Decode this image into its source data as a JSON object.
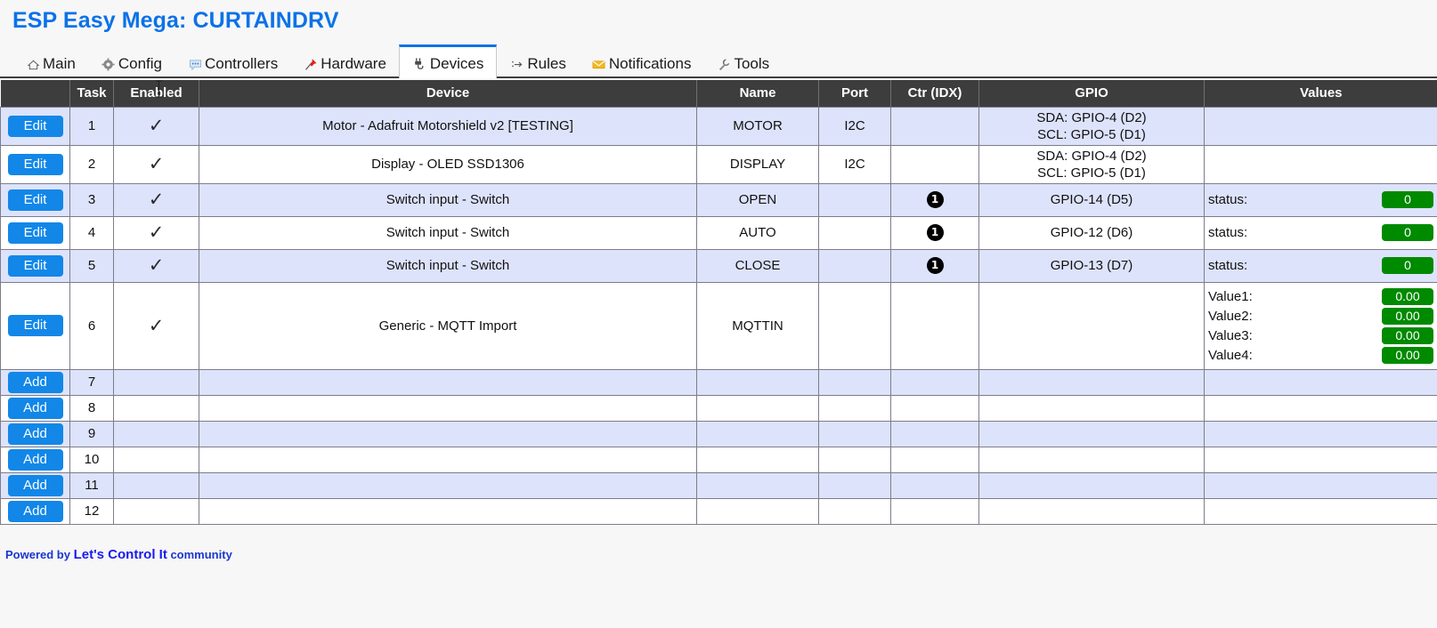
{
  "header": {
    "title": "ESP Easy Mega: CURTAINDRV",
    "title_color": "#0b72e7"
  },
  "tabs": [
    {
      "label": "Main",
      "icon": "home-icon",
      "active": false
    },
    {
      "label": "Config",
      "icon": "gear-icon",
      "active": false
    },
    {
      "label": "Controllers",
      "icon": "speech-bubble-icon",
      "active": false
    },
    {
      "label": "Hardware",
      "icon": "pin-icon",
      "active": false
    },
    {
      "label": "Devices",
      "icon": "plug-icon",
      "active": true
    },
    {
      "label": "Rules",
      "icon": "arrow-icon",
      "active": false
    },
    {
      "label": "Notifications",
      "icon": "envelope-icon",
      "active": false
    },
    {
      "label": "Tools",
      "icon": "wrench-icon",
      "active": false
    }
  ],
  "table": {
    "columns": [
      "",
      "Task",
      "Enabled",
      "Device",
      "Name",
      "Port",
      "Ctr (IDX)",
      "GPIO",
      "Values"
    ],
    "rows": [
      {
        "action": "Edit",
        "task": "1",
        "enabled": "✓",
        "device": "Motor - Adafruit Motorshield v2 [TESTING]",
        "name": "MOTOR",
        "port": "I2C",
        "ctr": "",
        "gpio": [
          "SDA: GPIO-4 (D2)",
          "SCL: GPIO-5 (D1)"
        ],
        "values": []
      },
      {
        "action": "Edit",
        "task": "2",
        "enabled": "✓",
        "device": "Display - OLED SSD1306",
        "name": "DISPLAY",
        "port": "I2C",
        "ctr": "",
        "gpio": [
          "SDA: GPIO-4 (D2)",
          "SCL: GPIO-5 (D1)"
        ],
        "values": []
      },
      {
        "action": "Edit",
        "task": "3",
        "enabled": "✓",
        "device": "Switch input - Switch",
        "name": "OPEN",
        "port": "",
        "ctr": "1",
        "gpio": [
          "GPIO-14 (D5)"
        ],
        "values": [
          {
            "label": "status:",
            "value": "0"
          }
        ]
      },
      {
        "action": "Edit",
        "task": "4",
        "enabled": "✓",
        "device": "Switch input - Switch",
        "name": "AUTO",
        "port": "",
        "ctr": "1",
        "gpio": [
          "GPIO-12 (D6)"
        ],
        "values": [
          {
            "label": "status:",
            "value": "0"
          }
        ]
      },
      {
        "action": "Edit",
        "task": "5",
        "enabled": "✓",
        "device": "Switch input - Switch",
        "name": "CLOSE",
        "port": "",
        "ctr": "1",
        "gpio": [
          "GPIO-13 (D7)"
        ],
        "values": [
          {
            "label": "status:",
            "value": "0"
          }
        ]
      },
      {
        "action": "Edit",
        "task": "6",
        "enabled": "✓",
        "device": "Generic - MQTT Import",
        "name": "MQTTIN",
        "port": "",
        "ctr": "",
        "gpio": [],
        "values": [
          {
            "label": "Value1:",
            "value": "0.00"
          },
          {
            "label": "Value2:",
            "value": "0.00"
          },
          {
            "label": "Value3:",
            "value": "0.00"
          },
          {
            "label": "Value4:",
            "value": "0.00"
          }
        ]
      },
      {
        "action": "Add",
        "task": "7",
        "enabled": "",
        "device": "",
        "name": "",
        "port": "",
        "ctr": "",
        "gpio": [],
        "values": []
      },
      {
        "action": "Add",
        "task": "8",
        "enabled": "",
        "device": "",
        "name": "",
        "port": "",
        "ctr": "",
        "gpio": [],
        "values": []
      },
      {
        "action": "Add",
        "task": "9",
        "enabled": "",
        "device": "",
        "name": "",
        "port": "",
        "ctr": "",
        "gpio": [],
        "values": []
      },
      {
        "action": "Add",
        "task": "10",
        "enabled": "",
        "device": "",
        "name": "",
        "port": "",
        "ctr": "",
        "gpio": [],
        "values": []
      },
      {
        "action": "Add",
        "task": "11",
        "enabled": "",
        "device": "",
        "name": "",
        "port": "",
        "ctr": "",
        "gpio": [],
        "values": []
      },
      {
        "action": "Add",
        "task": "12",
        "enabled": "",
        "device": "",
        "name": "",
        "port": "",
        "ctr": "",
        "gpio": [],
        "values": []
      }
    ]
  },
  "footer": {
    "prefix": "Powered by",
    "link": "Let's Control It",
    "suffix": "community"
  },
  "colors": {
    "accent": "#0b72e7",
    "button": "#1287e8",
    "badge_green": "#008a00",
    "header_bar": "#3d3d3d",
    "row_alt": "#dde3fb"
  }
}
